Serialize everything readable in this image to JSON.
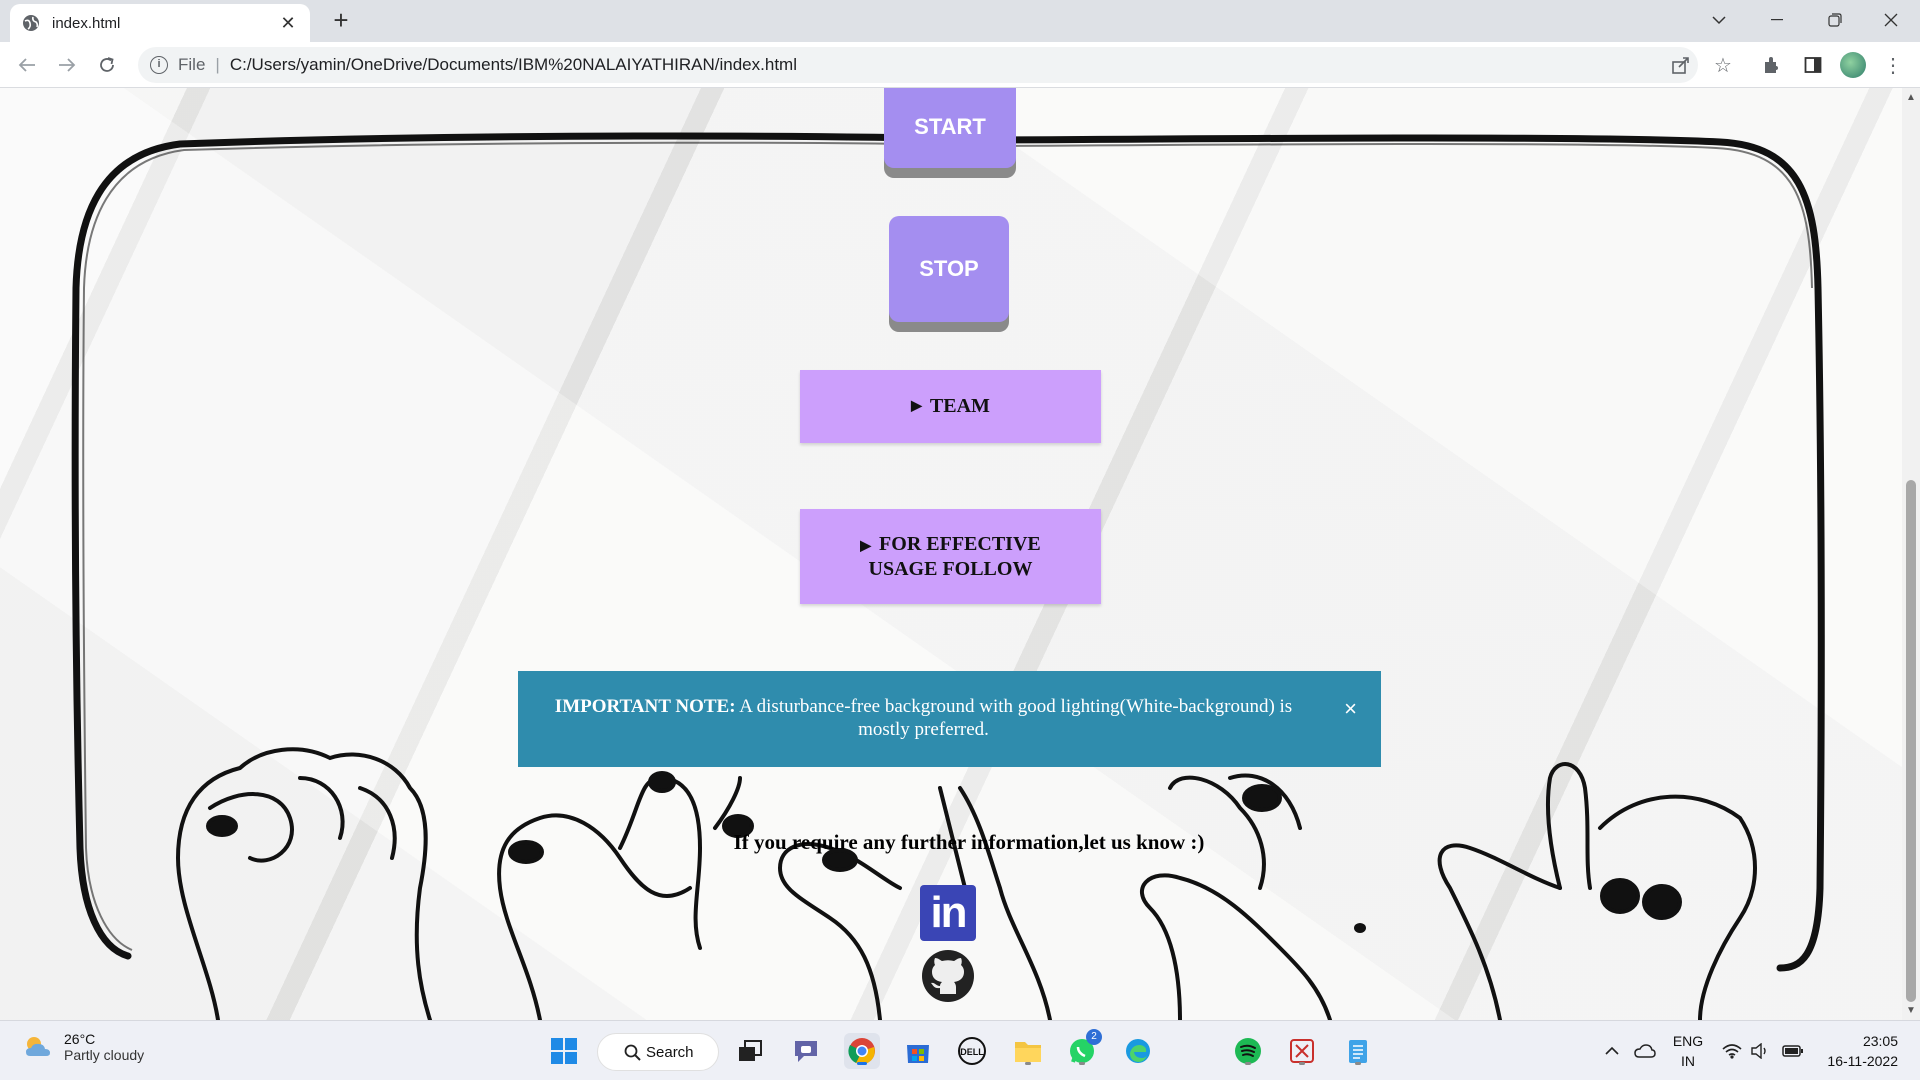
{
  "browser": {
    "tab_title": "index.html",
    "url_scheme": "File",
    "url": "C:/Users/yamin/OneDrive/Documents/IBM%20NALAIYATHIRAN/index.html"
  },
  "page": {
    "start_label": "START",
    "stop_label": "STOP",
    "team_label": "TEAM",
    "usage_label": "FOR EFFECTIVE USAGE FOLLOW",
    "alert": {
      "bold": "IMPORTANT NOTE:",
      "text": " A disturbance-free background with good lighting(White-background) is mostly preferred.",
      "close": "×"
    },
    "info_line": "If you require any further information,let us know :)",
    "linkedin_text": "in",
    "colors": {
      "button": "#a48ef0",
      "details": "#cc9ffc",
      "alert": "#2f8cad",
      "linkedin": "#3a45b5"
    }
  },
  "taskbar": {
    "temperature": "26°C",
    "weather": "Partly cloudy",
    "search_label": "Search",
    "whatsapp_badge": "2",
    "lang_top": "ENG",
    "lang_bottom": "IN",
    "time": "23:05",
    "date": "16-11-2022"
  }
}
